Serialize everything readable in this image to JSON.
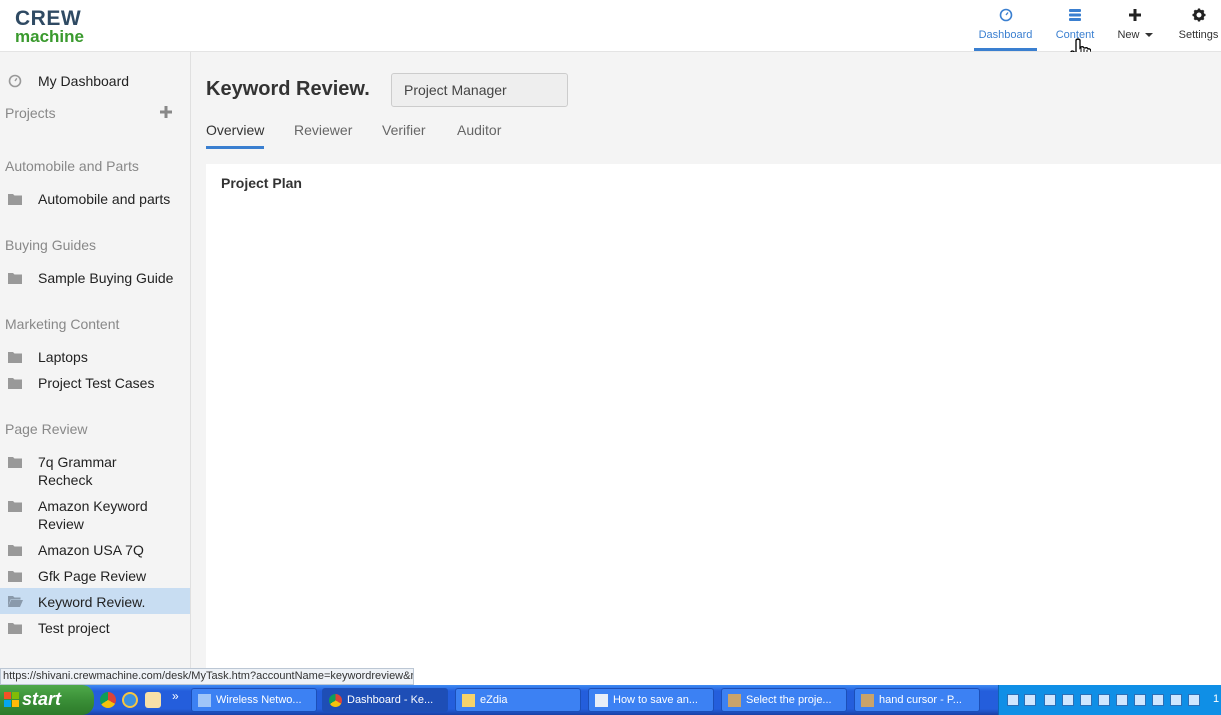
{
  "header": {
    "logo_line1": "CREW",
    "logo_line2": "machine",
    "nav": [
      {
        "label": "Dashboard",
        "icon": "dashboard-gauge-icon"
      },
      {
        "label": "Content",
        "icon": "content-stack-icon"
      },
      {
        "label": "New",
        "icon": "plus-icon"
      },
      {
        "label": "Settings",
        "icon": "gear-icon"
      }
    ],
    "accent": "#3a7fd0"
  },
  "sidebar": {
    "my_dashboard": "My Dashboard",
    "projects_label": "Projects",
    "groups": [
      {
        "name": "Automobile and Parts",
        "items": [
          "Automobile and parts"
        ]
      },
      {
        "name": "Buying Guides",
        "items": [
          "Sample Buying Guide"
        ]
      },
      {
        "name": "Marketing Content",
        "items": [
          "Laptops",
          "Project Test Cases"
        ]
      },
      {
        "name": "Page Review",
        "items": [
          "7q Grammar Recheck",
          "Amazon Keyword Review",
          "Amazon USA 7Q",
          "Gfk Page Review",
          "Keyword Review.",
          "Test project"
        ]
      }
    ],
    "selected_item": "Keyword Review."
  },
  "main": {
    "title": "Keyword Review.",
    "role_select_value": "Project Manager",
    "tabs": [
      "Overview",
      "Reviewer",
      "Verifier",
      "Auditor"
    ],
    "active_tab": "Overview",
    "panel_title": "Project Plan"
  },
  "status_url": "https://shivani.crewmachine.com/desk/MyTask.htm?accountName=keywordreview&r...",
  "taskbar": {
    "start_label": "start",
    "tasks": [
      {
        "label": "Wireless Netwo...",
        "icon": "wireless-icon"
      },
      {
        "label": "Dashboard - Ke...",
        "icon": "chrome-icon"
      },
      {
        "label": "eZdia",
        "icon": "folder-icon"
      },
      {
        "label": "How to save an...",
        "icon": "word-icon"
      },
      {
        "label": "Select the proje...",
        "icon": "paint-icon"
      },
      {
        "label": "hand cursor - P...",
        "icon": "paint-icon"
      }
    ],
    "quicklaunch_more": "»",
    "clock": "1"
  }
}
